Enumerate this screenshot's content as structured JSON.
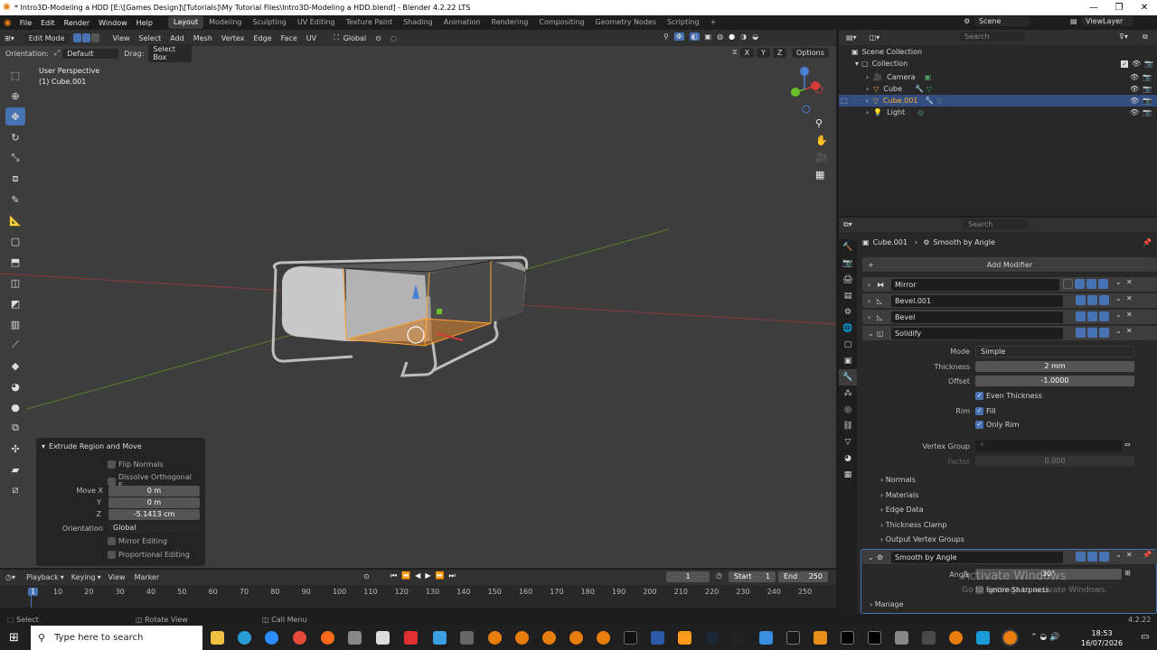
{
  "window": {
    "title": "* Intro3D-Modeling a HDD [E:\\[Games Design]\\[Tutorials]\\My Tutorial Files\\Intro3D-Modeling a HDD.blend] - Blender 4.2.22 LTS"
  },
  "menu": [
    "File",
    "Edit",
    "Render",
    "Window",
    "Help"
  ],
  "workspaces": [
    "Layout",
    "Modeling",
    "Sculpting",
    "UV Editing",
    "Texture Paint",
    "Shading",
    "Animation",
    "Rendering",
    "Compositing",
    "Geometry Nodes",
    "Scripting"
  ],
  "scene": "Scene",
  "view_layer": "ViewLayer",
  "viewport": {
    "mode": "Edit Mode",
    "menus": [
      "View",
      "Select",
      "Add",
      "Mesh",
      "Vertex",
      "Edge",
      "Face",
      "UV"
    ],
    "transform": "Global",
    "orientation_label": "Orientation:",
    "orientation_value": "Default",
    "drag_label": "Drag:",
    "drag_value": "Select Box",
    "axes": [
      "X",
      "Y",
      "Z"
    ],
    "options": "Options",
    "perspective": "User Perspective",
    "object": "(1) Cube.001"
  },
  "operator": {
    "title": "Extrude Region and Move",
    "flip_normals": "Flip Normals",
    "dissolve": "Dissolve Orthogonal E...",
    "move_label": "Move",
    "x_label": "X",
    "y_label": "Y",
    "z_label": "Z",
    "x": "0 m",
    "y": "0 m",
    "z": "-5.1413 cm",
    "orientation_label": "Orientation",
    "orientation": "Global",
    "mirror": "Mirror Editing",
    "proportional": "Proportional Editing"
  },
  "outliner": {
    "search_placeholder": "Search",
    "root": "Scene Collection",
    "collection": "Collection",
    "items": [
      {
        "name": "Camera"
      },
      {
        "name": "Cube"
      },
      {
        "name": "Cube.001"
      },
      {
        "name": "Light"
      }
    ]
  },
  "properties": {
    "search_placeholder": "Search",
    "breadcrumb_object": "Cube.001",
    "breadcrumb_modifier": "Smooth by Angle",
    "add_modifier": "Add Modifier",
    "modifiers": [
      "Mirror",
      "Bevel.001",
      "Bevel",
      "Solidify"
    ],
    "solidify": {
      "mode_label": "Mode",
      "mode": "Simple",
      "thickness_label": "Thickness",
      "thickness": "2 mm",
      "offset_label": "Offset",
      "offset": "-1.0000",
      "even_thickness": "Even Thickness",
      "rim_label": "Rim",
      "fill": "Fill",
      "only_rim": "Only Rim",
      "vgroup_label": "Vertex Group",
      "factor_label": "Factor",
      "factor": "0.000",
      "sections": [
        "Normals",
        "Materials",
        "Edge Data",
        "Thickness Clamp",
        "Output Vertex Groups"
      ]
    },
    "smooth": {
      "name": "Smooth by Angle",
      "angle_label": "Angle",
      "angle": "30°",
      "ignore": "Ignore Sharpness",
      "manage": "Manage"
    },
    "watermark1": "Activate Windows",
    "watermark2": "Go to Settings to activate Windows."
  },
  "timeline": {
    "menus": [
      "Playback",
      "Keying",
      "View",
      "Marker"
    ],
    "current": "1",
    "start_label": "Start",
    "start": "1",
    "end_label": "End",
    "end": "250",
    "ticks": [
      "1",
      "10",
      "20",
      "30",
      "40",
      "50",
      "60",
      "70",
      "80",
      "90",
      "100",
      "110",
      "120",
      "130",
      "140",
      "150",
      "160",
      "170",
      "180",
      "190",
      "200",
      "210",
      "220",
      "230",
      "240",
      "250"
    ]
  },
  "status": {
    "select": "Select",
    "rotate": "Rotate View",
    "call_menu": "Call Menu",
    "version": "4.2.22"
  },
  "taskbar": {
    "search_placeholder": "Type here to search",
    "time": "18:53",
    "date": "16/07/2026"
  },
  "colors": {
    "accent": "#4772b3",
    "selected_row": "#334d80",
    "edge_orange": "#ffa033"
  }
}
